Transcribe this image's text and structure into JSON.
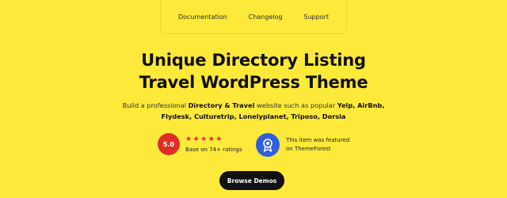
{
  "nav": {
    "items": [
      "Documentation",
      "Changelog",
      "Support"
    ]
  },
  "hero": {
    "title_line1": "Unique Directory Listing",
    "title_line2": "Travel WordPress Theme",
    "desc": {
      "part1": "Build a professional ",
      "bold1": "Directory & Travel",
      "part2": " website such as popular ",
      "bold2": "Yelp, AirBnb,",
      "bold3": "Flydesk, Culturetrip, Lonelyplanet, Triposo, Dorsia"
    }
  },
  "rating": {
    "score": "5.0",
    "stars": "★★★★★",
    "label": "Base on 74+ ratings"
  },
  "featured": {
    "line1": "This item was featured",
    "line2": "on ThemeForest"
  },
  "cta": {
    "label": "Browse Demos"
  },
  "colors": {
    "background": "#fce93a",
    "rating_badge": "#e12e24",
    "featured_badge": "#2f5fdc",
    "button": "#111111"
  },
  "icons": {
    "featured": "award-ribbon-icon"
  }
}
